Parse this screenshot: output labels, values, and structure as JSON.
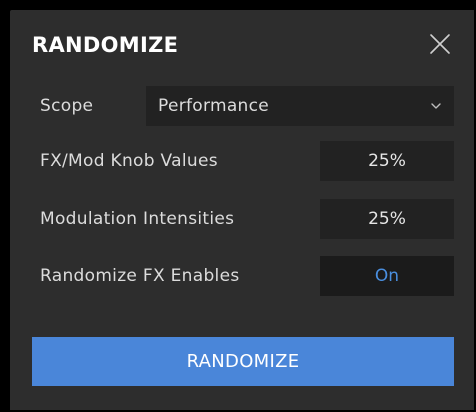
{
  "dialog": {
    "title": "RANDOMIZE",
    "close_icon": "close-icon"
  },
  "scope": {
    "label": "Scope",
    "value": "Performance",
    "chevron_icon": "chevron-down-icon"
  },
  "rows": [
    {
      "label": "FX/Mod Knob Values",
      "value": "25%"
    },
    {
      "label": "Modulation Intensities",
      "value": "25%"
    },
    {
      "label": "Randomize FX Enables",
      "value": "On"
    }
  ],
  "action": {
    "label": "RANDOMIZE"
  },
  "colors": {
    "accent": "#4a86d9",
    "toggle_on": "#4a8fe0",
    "panel_bg": "#2d2d2d",
    "field_bg": "#222222"
  }
}
